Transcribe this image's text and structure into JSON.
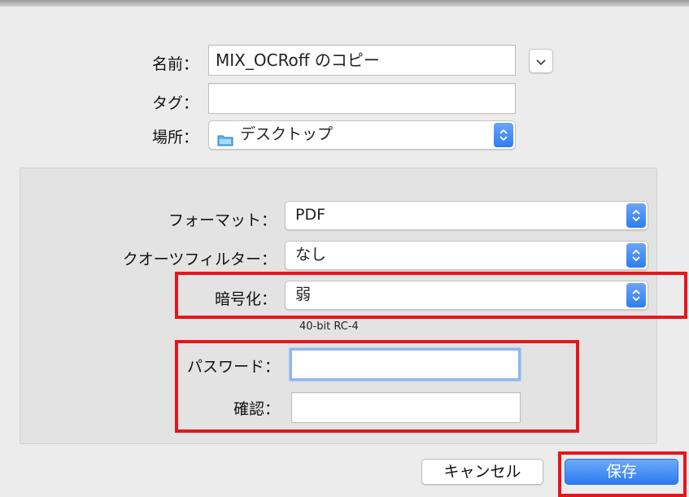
{
  "save_dialog": {
    "name_label": "名前：",
    "name_value": "MIX_OCRoff のコピー",
    "tags_label": "タグ：",
    "tags_value": "",
    "location_label": "場所：",
    "location_value": "デスクトップ"
  },
  "options": {
    "format_label": "フォーマット：",
    "format_value": "PDF",
    "quartz_label": "クオーツフィルター：",
    "quartz_value": "なし",
    "encryption_label": "暗号化：",
    "encryption_value": "弱",
    "encryption_note": "40-bit RC-4",
    "password_label": "パスワード：",
    "password_value": "",
    "verify_label": "確認：",
    "verify_value": ""
  },
  "buttons": {
    "cancel": "キャンセル",
    "save": "保存"
  },
  "icons": {
    "location": "folder-icon",
    "disclosure": "chevron-down-icon",
    "popup": "up-down-arrows-icon"
  },
  "highlight_color": "#e8151b",
  "accent_color": "#2f7cf0"
}
